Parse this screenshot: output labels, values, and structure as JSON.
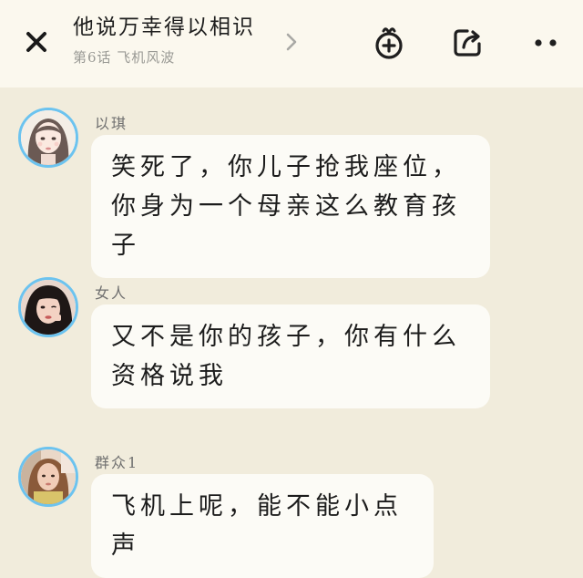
{
  "header": {
    "title": "他说万幸得以相识",
    "subtitle": "第6话 飞机风波",
    "close_icon": "close-icon",
    "chevron_icon": "chevron-right-icon",
    "gift_icon": "gift-plus-icon",
    "share_icon": "share-icon",
    "more_icon": "more-icon"
  },
  "messages": [
    {
      "name": "以琪",
      "text": "笑死了，你儿子抢我座位，你身为一个母亲这么教育孩子",
      "avatar_icon": "avatar-yiqi"
    },
    {
      "name": "女人",
      "text": "又不是你的孩子，你有什么资格说我",
      "avatar_icon": "avatar-woman"
    },
    {
      "name": "群众1",
      "text": "飞机上呢，能不能小点声",
      "avatar_icon": "avatar-crowd1"
    }
  ],
  "colors": {
    "background": "#f1ecdc",
    "header": "#fbf8ee",
    "bubble": "#fcfbf6",
    "avatar_border": "#6cc3ef"
  }
}
